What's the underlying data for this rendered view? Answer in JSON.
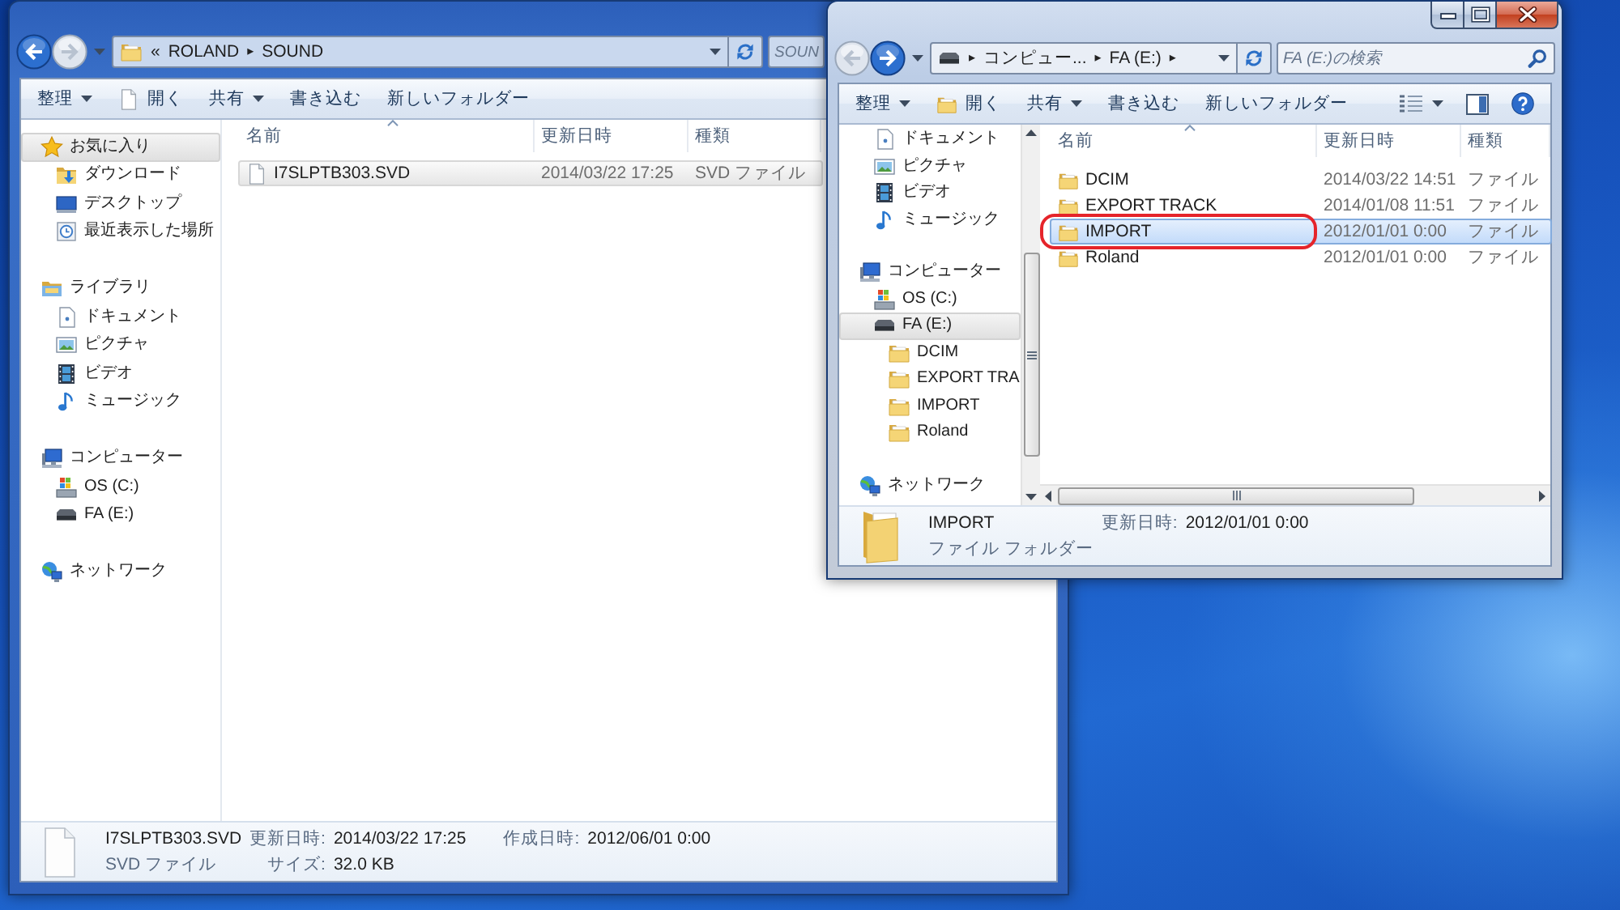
{
  "windows": [
    {
      "active": false,
      "back": {
        "disabled": false
      },
      "forward": {
        "disabled": true
      },
      "address": {
        "kind": "folder",
        "path": [
          {
            "kind": "overflow",
            "text": "«"
          },
          {
            "kind": "crumb",
            "text": "ROLAND"
          },
          {
            "kind": "separator",
            "text": "▸"
          },
          {
            "kind": "crumb",
            "text": "SOUND"
          }
        ]
      },
      "search": {
        "placeholder": "SOUN",
        "icon": false
      },
      "toolbar": [
        {
          "kind": "menu",
          "label": "整理"
        },
        {
          "kind": "file",
          "label": "開く"
        },
        {
          "kind": "menu",
          "label": "共有"
        },
        {
          "kind": "plain",
          "label": "書き込む"
        },
        {
          "kind": "plain",
          "label": "新しいフォルダー"
        }
      ],
      "navigation": [
        {
          "kind": "star",
          "label": "お気に入り",
          "selected": true,
          "children": [
            {
              "kind": "download",
              "label": "ダウンロード",
              "selected": false
            },
            {
              "kind": "desktop",
              "label": "デスクトップ",
              "selected": false
            },
            {
              "kind": "recent",
              "label": "最近表示した場所",
              "selected": false
            }
          ]
        },
        {
          "kind": "library",
          "label": "ライブラリ",
          "selected": false,
          "children": [
            {
              "kind": "document",
              "label": "ドキュメント",
              "selected": false
            },
            {
              "kind": "picture",
              "label": "ピクチャ",
              "selected": false
            },
            {
              "kind": "video",
              "label": "ビデオ",
              "selected": false
            },
            {
              "kind": "music",
              "label": "ミュージック",
              "selected": false
            }
          ]
        },
        {
          "kind": "computer",
          "label": "コンピューター",
          "selected": false,
          "children": [
            {
              "kind": "system-drive",
              "label": "OS (C:)",
              "selected": false
            },
            {
              "kind": "drive",
              "label": "FA (E:)",
              "selected": false
            }
          ]
        },
        {
          "kind": "network",
          "label": "ネットワーク",
          "selected": false
        }
      ],
      "columns": [
        {
          "label": "名前",
          "sorted": true
        },
        {
          "label": "更新日時",
          "sorted": false
        },
        {
          "label": "種類",
          "sorted": false
        }
      ],
      "rows": [
        {
          "kind": "file",
          "name": "I7SLPTB303.SVD",
          "modified": "2014/03/22 17:25",
          "type": "SVD ファイル",
          "selected": true,
          "circled": false
        }
      ],
      "details": {
        "kind": "file",
        "name": "I7SLPTB303.SVD",
        "type": "SVD ファイル",
        "fields": [
          {
            "label": "更新日時:",
            "value": "2014/03/22 17:25"
          },
          {
            "label": "作成日時:",
            "value": "2012/06/01 0:00"
          },
          {
            "label": "サイズ:",
            "value": "32.0 KB"
          }
        ]
      }
    },
    {
      "active": true,
      "caption_buttons": true,
      "view_tools": true,
      "scrollbars": true,
      "back": {
        "disabled": true
      },
      "forward": {
        "disabled": false
      },
      "address": {
        "kind": "drive",
        "path": [
          {
            "kind": "separator",
            "text": "▸"
          },
          {
            "kind": "crumb",
            "text": "コンピュー..."
          },
          {
            "kind": "separator",
            "text": "▸"
          },
          {
            "kind": "crumb",
            "text": "FA (E:)"
          },
          {
            "kind": "separator",
            "text": "▸"
          }
        ]
      },
      "search": {
        "placeholder": "FA (E:)の検索",
        "icon": true
      },
      "toolbar": [
        {
          "kind": "menu",
          "label": "整理"
        },
        {
          "kind": "folder",
          "label": "開く"
        },
        {
          "kind": "menu",
          "label": "共有"
        },
        {
          "kind": "plain",
          "label": "書き込む"
        },
        {
          "kind": "plain",
          "label": "新しいフォルダー"
        }
      ],
      "navigation": [
        {
          "children": [
            {
              "kind": "document",
              "label": "ドキュメント",
              "selected": false
            },
            {
              "kind": "picture",
              "label": "ピクチャ",
              "selected": false
            },
            {
              "kind": "video",
              "label": "ビデオ",
              "selected": false
            },
            {
              "kind": "music",
              "label": "ミュージック",
              "selected": false
            }
          ]
        },
        {
          "kind": "computer",
          "label": "コンピューター",
          "selected": false,
          "children": [
            {
              "kind": "system-drive",
              "label": "OS (C:)",
              "selected": false
            },
            {
              "kind": "drive",
              "label": "FA (E:)",
              "selected": true,
              "children": [
                {
                  "kind": "folder",
                  "label": "DCIM",
                  "selected": false
                },
                {
                  "kind": "folder",
                  "label": "EXPORT TRA",
                  "selected": false
                },
                {
                  "kind": "folder",
                  "label": "IMPORT",
                  "selected": false
                },
                {
                  "kind": "folder",
                  "label": "Roland",
                  "selected": false
                }
              ]
            }
          ]
        },
        {
          "kind": "network",
          "label": "ネットワーク",
          "selected": false
        }
      ],
      "columns": [
        {
          "label": "名前",
          "sorted": true
        },
        {
          "label": "更新日時",
          "sorted": false
        },
        {
          "label": "種類",
          "sorted": false
        }
      ],
      "rows": [
        {
          "kind": "folder",
          "name": "DCIM",
          "modified": "2014/03/22 14:51",
          "type": "ファイル",
          "selected": false,
          "circled": false
        },
        {
          "kind": "folder",
          "name": "EXPORT TRACK",
          "modified": "2014/01/08 11:51",
          "type": "ファイル",
          "selected": false,
          "circled": false
        },
        {
          "kind": "folder",
          "name": "IMPORT",
          "modified": "2012/01/01 0:00",
          "type": "ファイル",
          "selected": true,
          "circled": true
        },
        {
          "kind": "folder",
          "name": "Roland",
          "modified": "2012/01/01 0:00",
          "type": "ファイル",
          "selected": false,
          "circled": false
        }
      ],
      "details": {
        "kind": "folder",
        "name": "IMPORT",
        "type": "ファイル フォルダー",
        "fields": [
          {
            "label": "更新日時:",
            "value": "2012/01/01 0:00"
          }
        ]
      }
    }
  ]
}
